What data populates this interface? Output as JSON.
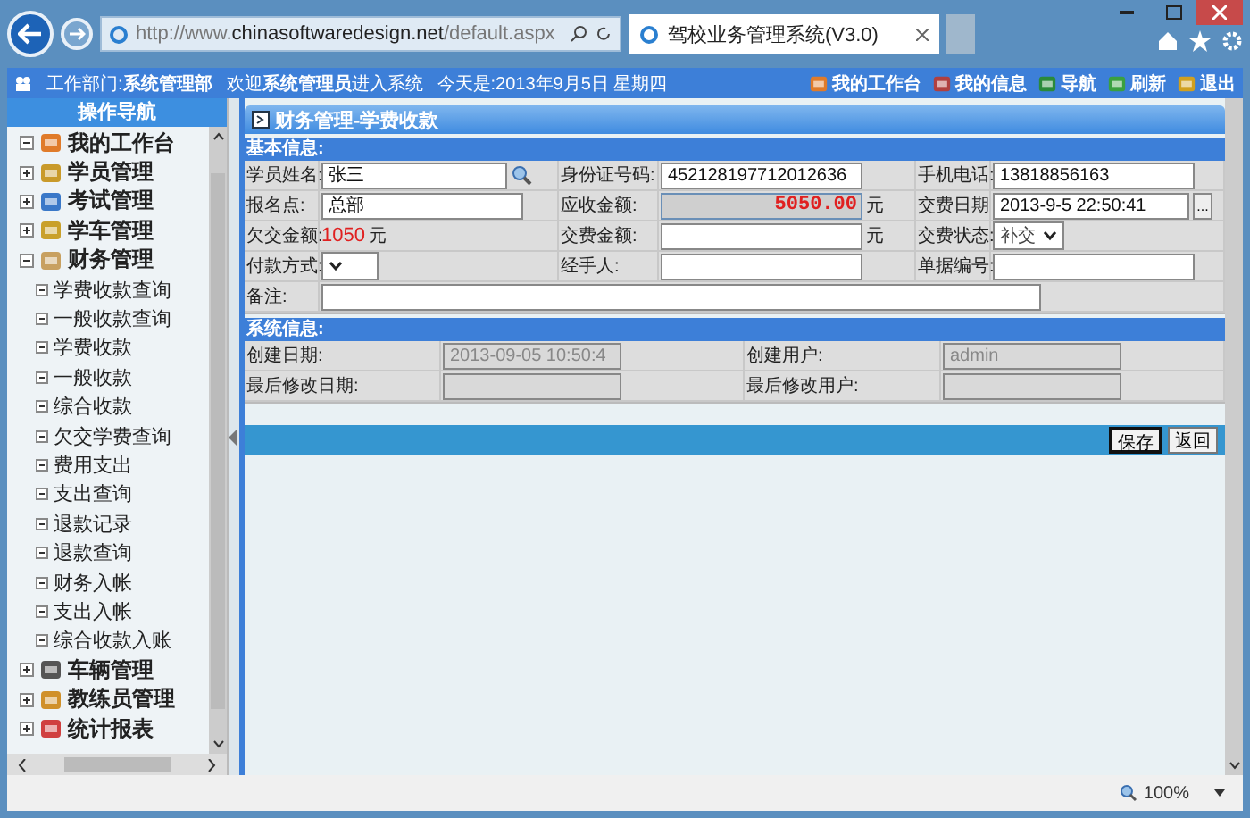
{
  "browser": {
    "address_prefix": "http://www.",
    "address_domain": "chinasoftwaredesign.net",
    "address_path": "/default.aspx",
    "tab_title": "驾校业务管理系统(V3.0)"
  },
  "header": {
    "department": "工作部门:**系统管理部**",
    "welcome": "欢迎**系统管理员**进入系统",
    "date": "今天是:2013年9月5日 星期四",
    "links": [
      {
        "label": "我的工作台"
      },
      {
        "label": "我的信息"
      },
      {
        "label": "导航"
      },
      {
        "label": "刷新"
      },
      {
        "label": "退出"
      }
    ]
  },
  "sidebar": {
    "title": "操作导航",
    "items": [
      {
        "label": "我的工作台",
        "expanded": true
      },
      {
        "label": "学员管理",
        "expanded": false
      },
      {
        "label": "考试管理",
        "expanded": false
      },
      {
        "label": "学车管理",
        "expanded": false
      },
      {
        "label": "财务管理",
        "expanded": true,
        "children": [
          {
            "label": "学费收款查询"
          },
          {
            "label": "一般收款查询"
          },
          {
            "label": "学费收款"
          },
          {
            "label": "一般收款"
          },
          {
            "label": "综合收款"
          },
          {
            "label": "欠交学费查询"
          },
          {
            "label": "费用支出"
          },
          {
            "label": "支出查询"
          },
          {
            "label": "退款记录"
          },
          {
            "label": "退款查询"
          },
          {
            "label": "财务入帐"
          },
          {
            "label": "支出入帐"
          },
          {
            "label": "综合收款入账"
          }
        ]
      },
      {
        "label": "车辆管理",
        "expanded": false
      },
      {
        "label": "教练员管理",
        "expanded": false
      },
      {
        "label": "统计报表",
        "expanded": false
      }
    ]
  },
  "page_title": "财务管理-学费收款",
  "basic_info": {
    "title": "基本信息:",
    "fields": [
      {
        "label": "学员姓名:",
        "kind": "input",
        "value": "张三",
        "lookup": true
      },
      {
        "label": "身份证号码:",
        "kind": "input",
        "value": "452128197712012636"
      },
      {
        "label": "手机电话:",
        "kind": "input",
        "value": "13818856163"
      },
      {
        "label": "报名点:",
        "kind": "input",
        "value": "总部"
      },
      {
        "label": "应收金额:",
        "kind": "total",
        "value": "5050.00",
        "suffix": "元"
      },
      {
        "label": "交费日期",
        "kind": "date",
        "value": "2013-9-5 22:50:41",
        "button": "..."
      },
      {
        "label": "欠交金额:",
        "kind": "amount",
        "value": "1050",
        "suffix": "元"
      },
      {
        "label": "交费金额:",
        "kind": "input",
        "suffix": "元"
      },
      {
        "label": "交费状态:",
        "kind": "select",
        "value": "补交"
      },
      {
        "label": "付款方式:",
        "kind": "select"
      },
      {
        "label": "经手人:",
        "kind": "input"
      },
      {
        "label": "单据编号:",
        "kind": "input"
      },
      {
        "label": "备注:",
        "kind": "wide"
      }
    ]
  },
  "system_info": {
    "title": "系统信息:",
    "fields": [
      {
        "label": "创建日期:",
        "value": "2013-09-05 10:50:4"
      },
      {
        "label": "创建用户:",
        "value": "admin"
      },
      {
        "label": "最后修改日期:"
      },
      {
        "label": "最后修改用户:"
      }
    ]
  },
  "buttons": [
    {
      "label": "保存",
      "focused": true
    },
    {
      "label": "返回",
      "focused": false
    }
  ],
  "status_bar": {
    "zoom": "100%"
  }
}
